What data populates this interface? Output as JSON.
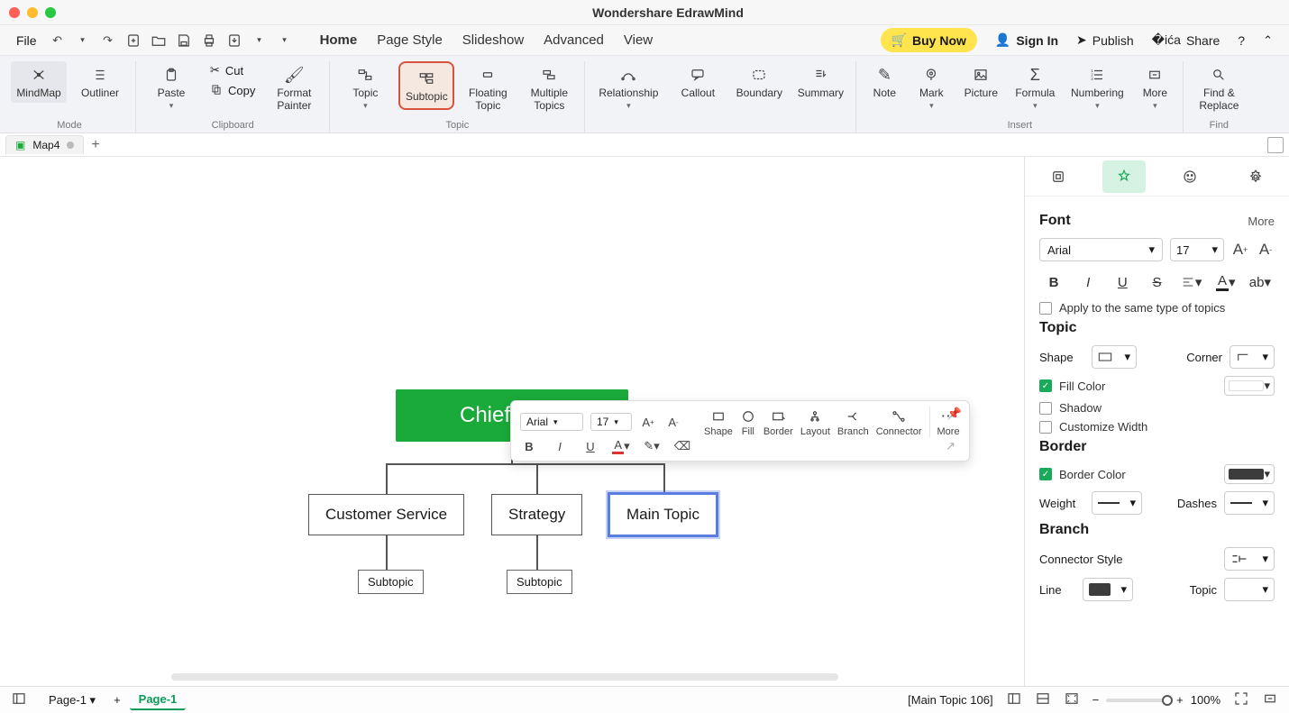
{
  "app": {
    "title": "Wondershare EdrawMind"
  },
  "menu": {
    "file": "File",
    "tabs": [
      "Home",
      "Page Style",
      "Slideshow",
      "Advanced",
      "View"
    ],
    "buy": "Buy Now",
    "signin": "Sign In",
    "publish": "Publish",
    "share": "Share"
  },
  "ribbon": {
    "mode": {
      "mindmap": "MindMap",
      "outliner": "Outliner",
      "label": "Mode"
    },
    "clipboard": {
      "paste": "Paste",
      "cut": "Cut",
      "copy": "Copy",
      "format": "Format Painter",
      "label": "Clipboard"
    },
    "topic_grp": {
      "topic": "Topic",
      "subtopic": "Subtopic",
      "floating": "Floating Topic",
      "multiple": "Multiple Topics",
      "label": "Topic"
    },
    "relate": {
      "relationship": "Relationship",
      "callout": "Callout",
      "boundary": "Boundary",
      "summary": "Summary"
    },
    "insert": {
      "note": "Note",
      "mark": "Mark",
      "picture": "Picture",
      "formula": "Formula",
      "numbering": "Numbering",
      "more": "More",
      "label": "Insert"
    },
    "find": {
      "findreplace": "Find & Replace",
      "label": "Find"
    }
  },
  "doc": {
    "tab": "Map4"
  },
  "nodes": {
    "root": "Chief Mark",
    "m1": "Customer Service",
    "m2": "Strategy",
    "m3": "Main Topic",
    "s1": "Subtopic",
    "s2": "Subtopic"
  },
  "float": {
    "font": "Arial",
    "size": "17",
    "shape": "Shape",
    "fill": "Fill",
    "border": "Border",
    "layout": "Layout",
    "branch": "Branch",
    "connector": "Connector",
    "more": "More"
  },
  "panel": {
    "font": {
      "title": "Font",
      "more": "More",
      "family": "Arial",
      "size": "17",
      "apply": "Apply to the same type of topics"
    },
    "topic": {
      "title": "Topic",
      "shape": "Shape",
      "corner": "Corner",
      "fill": "Fill Color",
      "shadow": "Shadow",
      "customw": "Customize Width"
    },
    "border": {
      "title": "Border",
      "color": "Border Color",
      "weight": "Weight",
      "dashes": "Dashes",
      "border_hex": "#3c3c3c"
    },
    "branch": {
      "title": "Branch",
      "style": "Connector Style",
      "line": "Line",
      "topic": "Topic",
      "line_hex": "#3c3c3c"
    }
  },
  "status": {
    "page_primary": "Page-1",
    "page_active": "Page-1",
    "selection": "[Main Topic 106]",
    "zoom": "100%"
  }
}
